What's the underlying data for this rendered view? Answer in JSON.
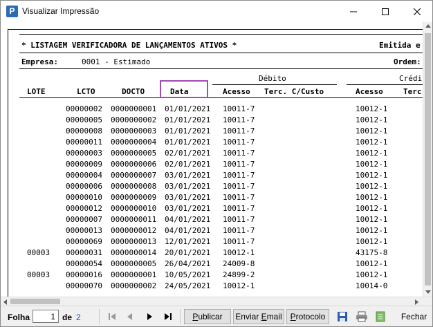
{
  "window": {
    "title": "Visualizar Impressão",
    "icon": "app-logo-icon"
  },
  "report": {
    "title": "* LISTAGEM VERIFICADORA DE LANÇAMENTOS ATIVOS *",
    "emitted_label": "Emitida e",
    "company_label": "Empresa:",
    "company_value": "0001 - Estimado",
    "order_label": "Ordem:",
    "group_debit": "Débito",
    "group_credit": "Crédi",
    "columns": [
      "LOTE",
      "LCTO",
      "DOCTO",
      "Data",
      "Acesso",
      "Terc. C/Custo",
      "Acesso",
      "Terc"
    ],
    "rows": [
      {
        "lote": "",
        "lcto": "00000002",
        "docto": "0000000001",
        "data": "01/01/2021",
        "acesso_d": "10011-7",
        "acesso_c": "10012-1"
      },
      {
        "lote": "",
        "lcto": "00000005",
        "docto": "0000000002",
        "data": "01/01/2021",
        "acesso_d": "10011-7",
        "acesso_c": "10012-1"
      },
      {
        "lote": "",
        "lcto": "00000008",
        "docto": "0000000003",
        "data": "01/01/2021",
        "acesso_d": "10011-7",
        "acesso_c": "10012-1"
      },
      {
        "lote": "",
        "lcto": "00000011",
        "docto": "0000000004",
        "data": "01/01/2021",
        "acesso_d": "10011-7",
        "acesso_c": "10012-1"
      },
      {
        "lote": "",
        "lcto": "00000003",
        "docto": "0000000005",
        "data": "02/01/2021",
        "acesso_d": "10011-7",
        "acesso_c": "10012-1"
      },
      {
        "lote": "",
        "lcto": "00000009",
        "docto": "0000000006",
        "data": "02/01/2021",
        "acesso_d": "10011-7",
        "acesso_c": "10012-1"
      },
      {
        "lote": "",
        "lcto": "00000004",
        "docto": "0000000007",
        "data": "03/01/2021",
        "acesso_d": "10011-7",
        "acesso_c": "10012-1"
      },
      {
        "lote": "",
        "lcto": "00000006",
        "docto": "0000000008",
        "data": "03/01/2021",
        "acesso_d": "10011-7",
        "acesso_c": "10012-1"
      },
      {
        "lote": "",
        "lcto": "00000010",
        "docto": "0000000009",
        "data": "03/01/2021",
        "acesso_d": "10011-7",
        "acesso_c": "10012-1"
      },
      {
        "lote": "",
        "lcto": "00000012",
        "docto": "0000000010",
        "data": "03/01/2021",
        "acesso_d": "10011-7",
        "acesso_c": "10012-1"
      },
      {
        "lote": "",
        "lcto": "00000007",
        "docto": "0000000011",
        "data": "04/01/2021",
        "acesso_d": "10011-7",
        "acesso_c": "10012-1"
      },
      {
        "lote": "",
        "lcto": "00000013",
        "docto": "0000000012",
        "data": "04/01/2021",
        "acesso_d": "10011-7",
        "acesso_c": "10012-1"
      },
      {
        "lote": "",
        "lcto": "00000069",
        "docto": "0000000013",
        "data": "12/01/2021",
        "acesso_d": "10011-7",
        "acesso_c": "10012-1"
      },
      {
        "lote": "00003",
        "lcto": "00000031",
        "docto": "0000000014",
        "data": "20/01/2021",
        "acesso_d": "10012-1",
        "acesso_c": "43175-8"
      },
      {
        "lote": "",
        "lcto": "00000054",
        "docto": "0000000005",
        "data": "26/04/2021",
        "acesso_d": "24009-8",
        "acesso_c": "10012-1"
      },
      {
        "lote": "00003",
        "lcto": "00000016",
        "docto": "0000000001",
        "data": "10/05/2021",
        "acesso_d": "24899-2",
        "acesso_c": "10012-1"
      },
      {
        "lote": "",
        "lcto": "00000070",
        "docto": "0000000002",
        "data": "24/05/2021",
        "acesso_d": "10012-1",
        "acesso_c": "10014-0"
      }
    ]
  },
  "toolbar": {
    "page_label": "Folha",
    "page_value": "1",
    "of_label": "de",
    "total_pages": "2",
    "publish_label": "Publicar",
    "email_label": "Enviar Email",
    "protocol_label": "Protocolo",
    "close_label": "Fechar"
  },
  "colors": {
    "highlight": "#a24bb3",
    "link": "#1a56b6"
  }
}
